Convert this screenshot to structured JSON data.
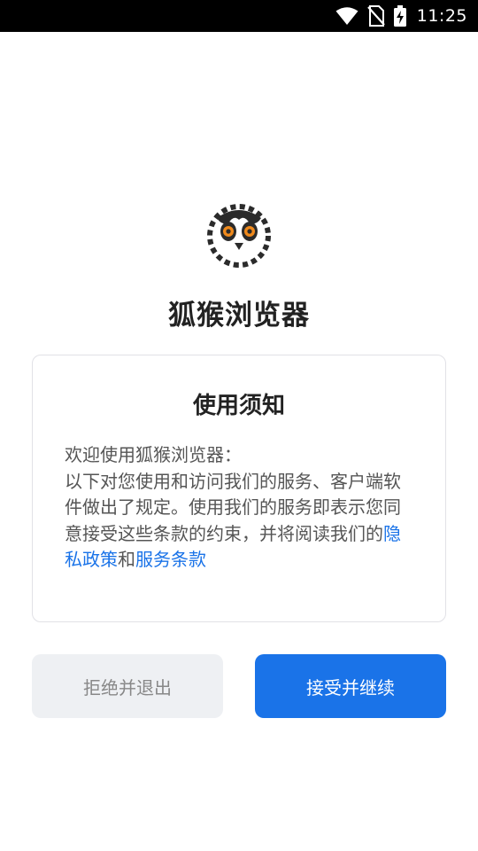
{
  "status_bar": {
    "time": "11:25",
    "icons": [
      "wifi-icon",
      "no-sim-icon",
      "battery-charging-icon"
    ]
  },
  "app": {
    "logo_icon": "lemur-face-icon",
    "name": "狐猴浏览器"
  },
  "notice": {
    "title": "使用须知",
    "line_intro": "欢迎使用狐猴浏览器：",
    "body_text": "以下对您使用和访问我们的服务、客户端软件做出了规定。使用我们的服务即表示您同意接受这些条款的约束，并将阅读我们的",
    "privacy_link": "隐私政策",
    "conjunction": "和",
    "terms_link": "服务条款"
  },
  "buttons": {
    "reject_label": "拒绝并退出",
    "accept_label": "接受并继续"
  },
  "colors": {
    "accent": "#1a73e8",
    "reject_bg": "#eef0f3",
    "logo_dark": "#2b2b2b",
    "logo_eye": "#f08a1c"
  }
}
